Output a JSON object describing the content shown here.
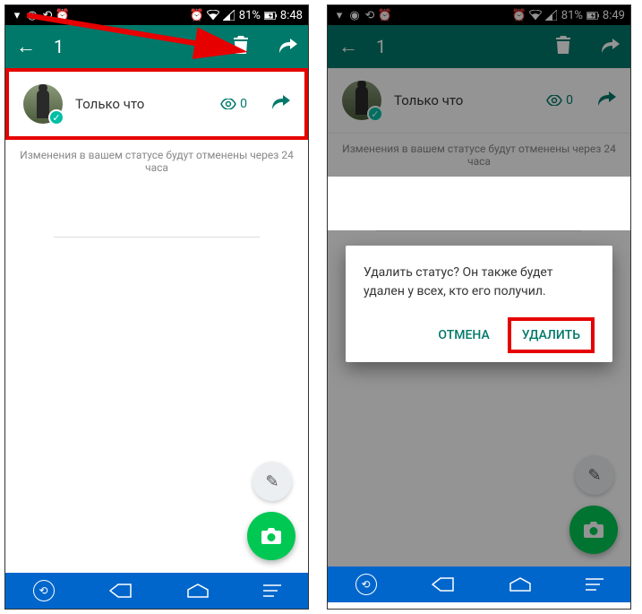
{
  "left": {
    "status_bar": {
      "battery": "81%",
      "time": "8:48"
    },
    "top_bar": {
      "counter": "1"
    },
    "row": {
      "timestamp": "Только что",
      "views": "0"
    },
    "hint": "Изменения в вашем статусе будут отменены через 24 часа"
  },
  "right": {
    "status_bar": {
      "battery": "81%",
      "time": "8:49"
    },
    "top_bar": {
      "counter": "1"
    },
    "row": {
      "timestamp": "Только что",
      "views": "0"
    },
    "hint": "Изменения в вашем статусе будут отменены через 24 часа",
    "dialog": {
      "message": "Удалить статус? Он также будет удален у всех, кто его получил.",
      "cancel": "ОТМЕНА",
      "delete": "УДАЛИТЬ"
    }
  }
}
